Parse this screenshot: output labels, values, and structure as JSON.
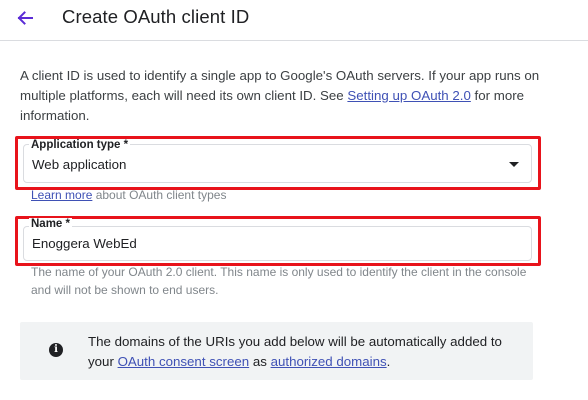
{
  "header": {
    "title": "Create OAuth client ID"
  },
  "intro": {
    "text_before": "A client ID is used to identify a single app to Google's OAuth servers. If your app runs on multiple platforms, each will need its own client ID. See ",
    "link": "Setting up OAuth 2.0",
    "text_after": " for more information."
  },
  "application_type": {
    "label": "Application type *",
    "value": "Web application",
    "hint_link": "Learn more",
    "hint_text": " about OAuth client types"
  },
  "name": {
    "label": "Name *",
    "value": "Enoggera WebEd",
    "hint": "The name of your OAuth 2.0 client. This name is only used to identify the client in the console and will not be shown to end users."
  },
  "info": {
    "text_before": "The domains of the URIs you add below will be automatically added to your ",
    "link1": "OAuth consent screen",
    "text_mid": " as ",
    "link2": "authorized domains",
    "text_after": "."
  },
  "colors": {
    "accent": "#3f51b5",
    "highlight": "#e8131b",
    "back_arrow": "#6200ea"
  },
  "icons": {
    "back": "arrow-left-icon",
    "dropdown": "dropdown-arrow-icon",
    "info": "info-icon"
  }
}
